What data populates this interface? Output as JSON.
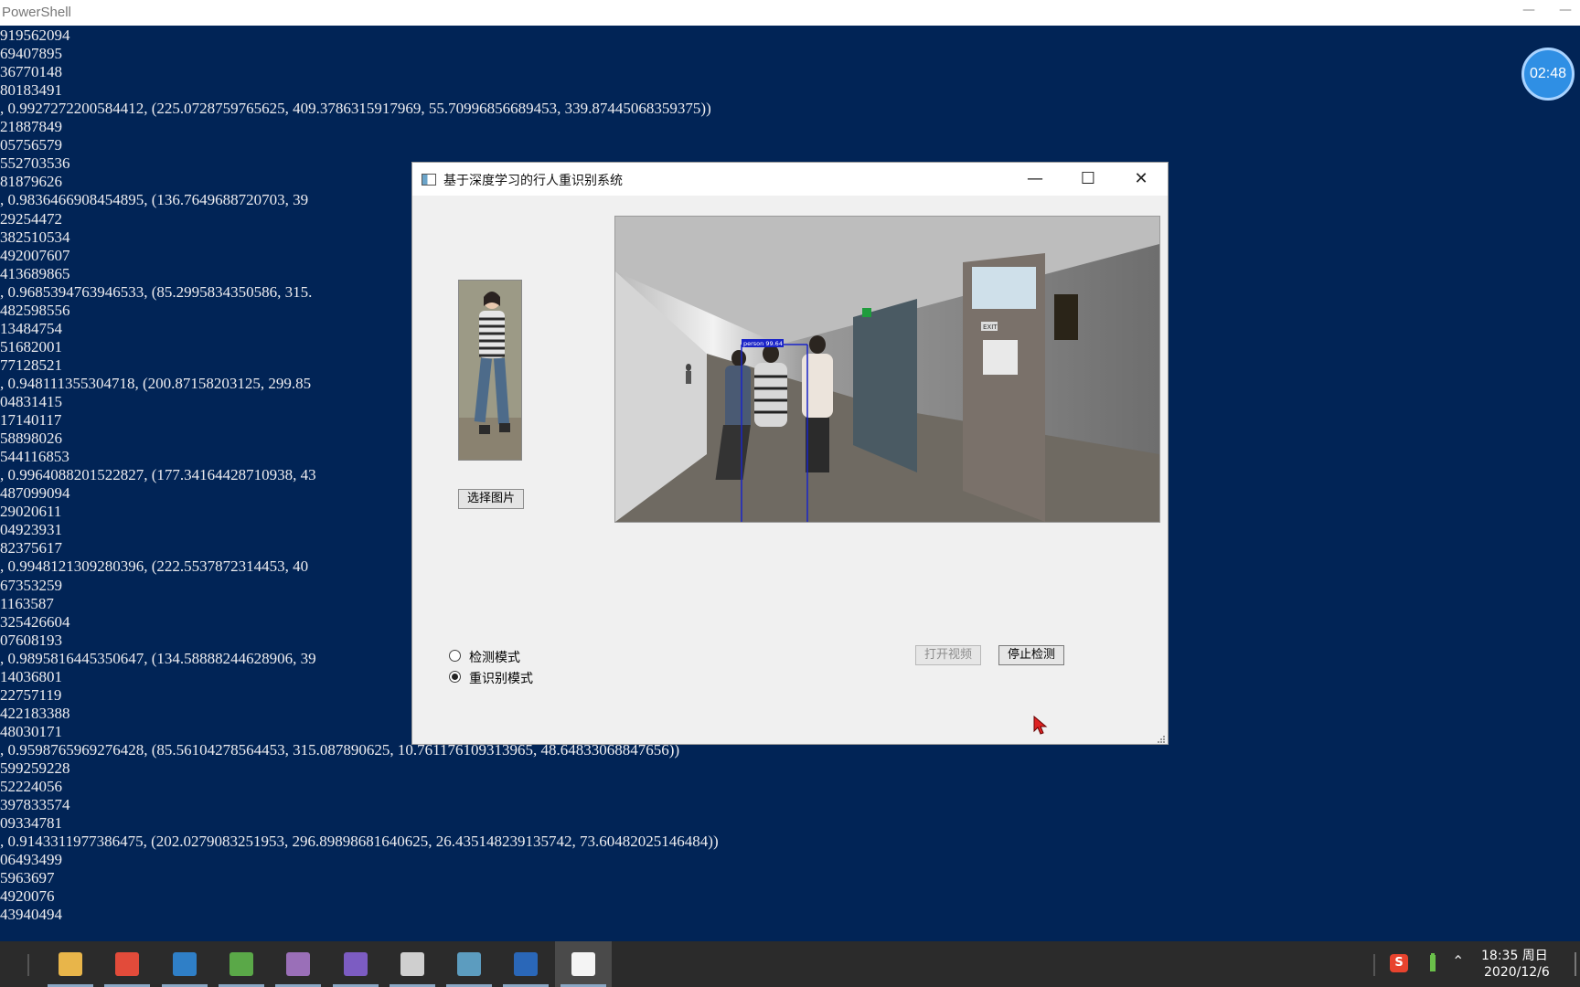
{
  "powershell": {
    "title": "PowerShell",
    "minimize_glyph": "—",
    "close_glyph": "—",
    "lines": [
      "919562094",
      "69407895",
      "36770148",
      "80183491",
      ", 0.9927272200584412, (225.0728759765625, 409.3786315917969, 55.70996856689453, 339.87445068359375))",
      "21887849",
      "05756579",
      "552703536",
      "81879626",
      ", 0.9836466908454895, (136.7649688720703, 39",
      "29254472",
      "382510534",
      "492007607",
      "413689865",
      ", 0.9685394763946533, (85.2995834350586, 315.",
      "482598556",
      "13484754",
      "51682001",
      "77128521",
      ", 0.948111355304718, (200.87158203125, 299.85",
      "04831415",
      "17140117",
      "58898026",
      "544116853",
      ", 0.9964088201522827, (177.34164428710938, 43",
      "487099094",
      "29020611",
      "04923931",
      "82375617",
      ", 0.9948121309280396, (222.5537872314453, 40",
      "67353259",
      "1163587",
      "325426604",
      "07608193",
      ", 0.9895816445350647, (134.58888244628906, 39",
      "14036801",
      "22757119",
      "422183388",
      "48030171",
      ", 0.9598765969276428, (85.56104278564453, 315.087890625, 10.761176109313965, 48.64833068847656))",
      "599259228",
      "52224056",
      "397833574",
      "09334781",
      ", 0.9143311977386475, (202.0279083251953, 296.89898681640625, 26.435148239135742, 73.60482025146484))",
      "06493499",
      "5963697",
      "4920076",
      "43940494"
    ]
  },
  "recording_timer": "02:48",
  "app": {
    "title": "基于深度学习的行人重识别系统",
    "minimize_glyph": "—",
    "maximize_glyph": "☐",
    "close_glyph": "✕",
    "select_image_button": "选择图片",
    "video_label": "person 99.64",
    "mode_detect": "检测模式",
    "mode_reid": "重识别模式",
    "selected_mode": "重识别模式",
    "open_video_button": "打开视频",
    "stop_detect_button": "停止检测",
    "exit_sign": "EXIT"
  },
  "taskbar": {
    "apps": [
      {
        "icon": "file-explorer-icon",
        "color": "#e8b54a"
      },
      {
        "icon": "chrome-icon",
        "color": "#e24b3a"
      },
      {
        "icon": "vscode-icon",
        "color": "#2f7fc7"
      },
      {
        "icon": "paint-icon",
        "color": "#5aa848"
      },
      {
        "icon": "photo-viewer-icon",
        "color": "#9a6fb8"
      },
      {
        "icon": "visual-studio-icon",
        "color": "#7c5cc2"
      },
      {
        "icon": "person-app-icon",
        "color": "#cfcfcf"
      },
      {
        "icon": "qt-window-icon",
        "color": "#5c9cbf"
      },
      {
        "icon": "powershell-icon",
        "color": "#2a67b8"
      },
      {
        "icon": "notepad-icon",
        "color": "#f4f4f4"
      }
    ],
    "active_index": 9,
    "tray_ime": "S",
    "clock_time": "18:35 周日",
    "clock_date": "2020/12/6"
  },
  "colors": {
    "console_bg": "#012456",
    "console_text": "#eeedf0",
    "window_bg": "#f0f0f0",
    "taskbar_bg": "#2b2b2b",
    "timer_bg": "#2f8fe4",
    "detection_box": "#1a24c8"
  }
}
